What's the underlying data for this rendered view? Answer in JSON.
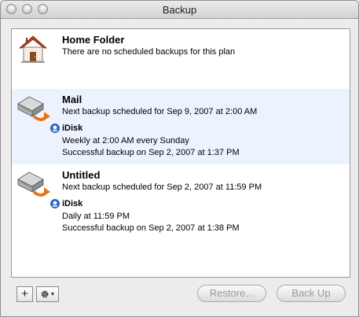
{
  "window": {
    "title": "Backup"
  },
  "plans": [
    {
      "name": "Home Folder",
      "status": "There are no scheduled backups for this plan",
      "icon": "house-icon",
      "destination": null
    },
    {
      "name": "Mail",
      "status": "Next backup scheduled for Sep 9, 2007 at 2:00 AM",
      "icon": "backup-drive-icon",
      "destination": {
        "name": "iDisk",
        "schedule": "Weekly at 2:00 AM every Sunday",
        "result": "Successful backup on Sep 2, 2007 at 1:37 PM"
      }
    },
    {
      "name": "Untitled",
      "status": "Next backup scheduled for Sep 2, 2007 at 11:59 PM",
      "icon": "backup-drive-icon",
      "destination": {
        "name": "iDisk",
        "schedule": "Daily at 11:59 PM",
        "result": "Successful backup on Sep 2, 2007 at 1:38 PM"
      }
    }
  ],
  "toolbar": {
    "add_label": "+",
    "action_icon": "gear-icon",
    "restore_label": "Restore...",
    "backup_label": "Back Up"
  },
  "colors": {
    "selected_row": "#edf3fe",
    "arrow": "#e8741c",
    "disabled_text": "#9a9a9a"
  }
}
